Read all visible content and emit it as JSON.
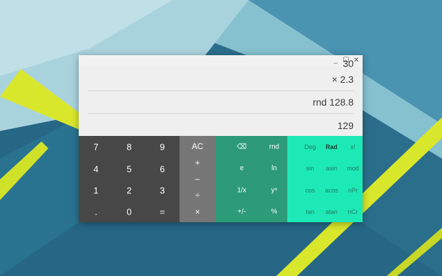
{
  "window": {
    "controls": {
      "minimize": "_",
      "maximize": "☐",
      "close": "✕"
    }
  },
  "display": {
    "lines": [
      "30",
      "× 2.3",
      "rnd 128.8",
      "129"
    ]
  },
  "keypad": {
    "numbers": [
      "7",
      "8",
      "9",
      "4",
      "5",
      "6",
      "1",
      "2",
      "3",
      ".",
      "0",
      "="
    ],
    "operators": [
      "AC",
      "+",
      "–",
      "÷",
      "×"
    ],
    "scientific": [
      "⌫",
      "rnd",
      "e",
      "ln",
      "1/x",
      "yⁿ",
      "+/-",
      "%"
    ],
    "advanced": [
      "Deg",
      "Rad",
      "x!",
      "sin",
      "asin",
      "mod",
      "cos",
      "acos",
      "nPr",
      "tan",
      "atan",
      "nCr"
    ],
    "angle_mode": "Rad"
  },
  "colors": {
    "number_pad": "#474747",
    "operator_pad": "#777777",
    "scientific_pad": "#2d9b77",
    "advanced_pad": "#1de9b6"
  }
}
